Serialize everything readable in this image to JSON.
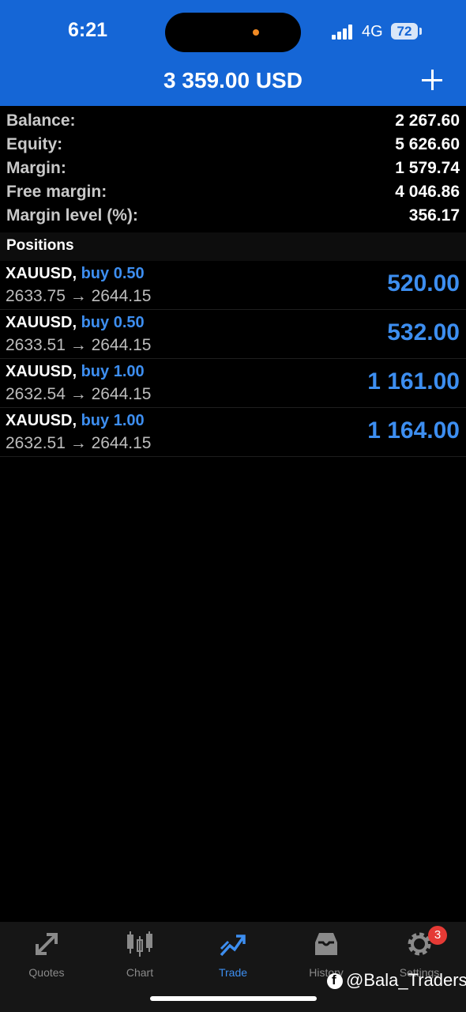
{
  "status_bar": {
    "time": "6:21",
    "network": "4G",
    "battery": "72"
  },
  "header": {
    "title": "3 359.00 USD"
  },
  "summary": [
    {
      "label": "Balance:",
      "value": "2 267.60"
    },
    {
      "label": "Equity:",
      "value": "5 626.60"
    },
    {
      "label": "Margin:",
      "value": "1 579.74"
    },
    {
      "label": "Free margin:",
      "value": "4 046.86"
    },
    {
      "label": "Margin level (%):",
      "value": "356.17"
    }
  ],
  "positions_header": "Positions",
  "positions": [
    {
      "symbol": "XAUUSD,",
      "side": "buy 0.50",
      "prices": "2633.75 → 2644.15",
      "profit": "520.00"
    },
    {
      "symbol": "XAUUSD,",
      "side": "buy 0.50",
      "prices": "2633.51 → 2644.15",
      "profit": "532.00"
    },
    {
      "symbol": "XAUUSD,",
      "side": "buy 1.00",
      "prices": "2632.54 → 2644.15",
      "profit": "1 161.00"
    },
    {
      "symbol": "XAUUSD,",
      "side": "buy 1.00",
      "prices": "2632.51 → 2644.15",
      "profit": "1 164.00"
    }
  ],
  "tabs": [
    {
      "label": "Quotes",
      "icon": "quotes-icon"
    },
    {
      "label": "Chart",
      "icon": "chart-icon"
    },
    {
      "label": "Trade",
      "icon": "trade-icon",
      "active": true
    },
    {
      "label": "History",
      "icon": "history-icon"
    },
    {
      "label": "Settings",
      "icon": "settings-icon",
      "badge": "3"
    }
  ],
  "watermark": "@Bala_Traders",
  "colors": {
    "header": "#1566d6",
    "accent": "#3d8ef0",
    "badge": "#e53a35"
  }
}
